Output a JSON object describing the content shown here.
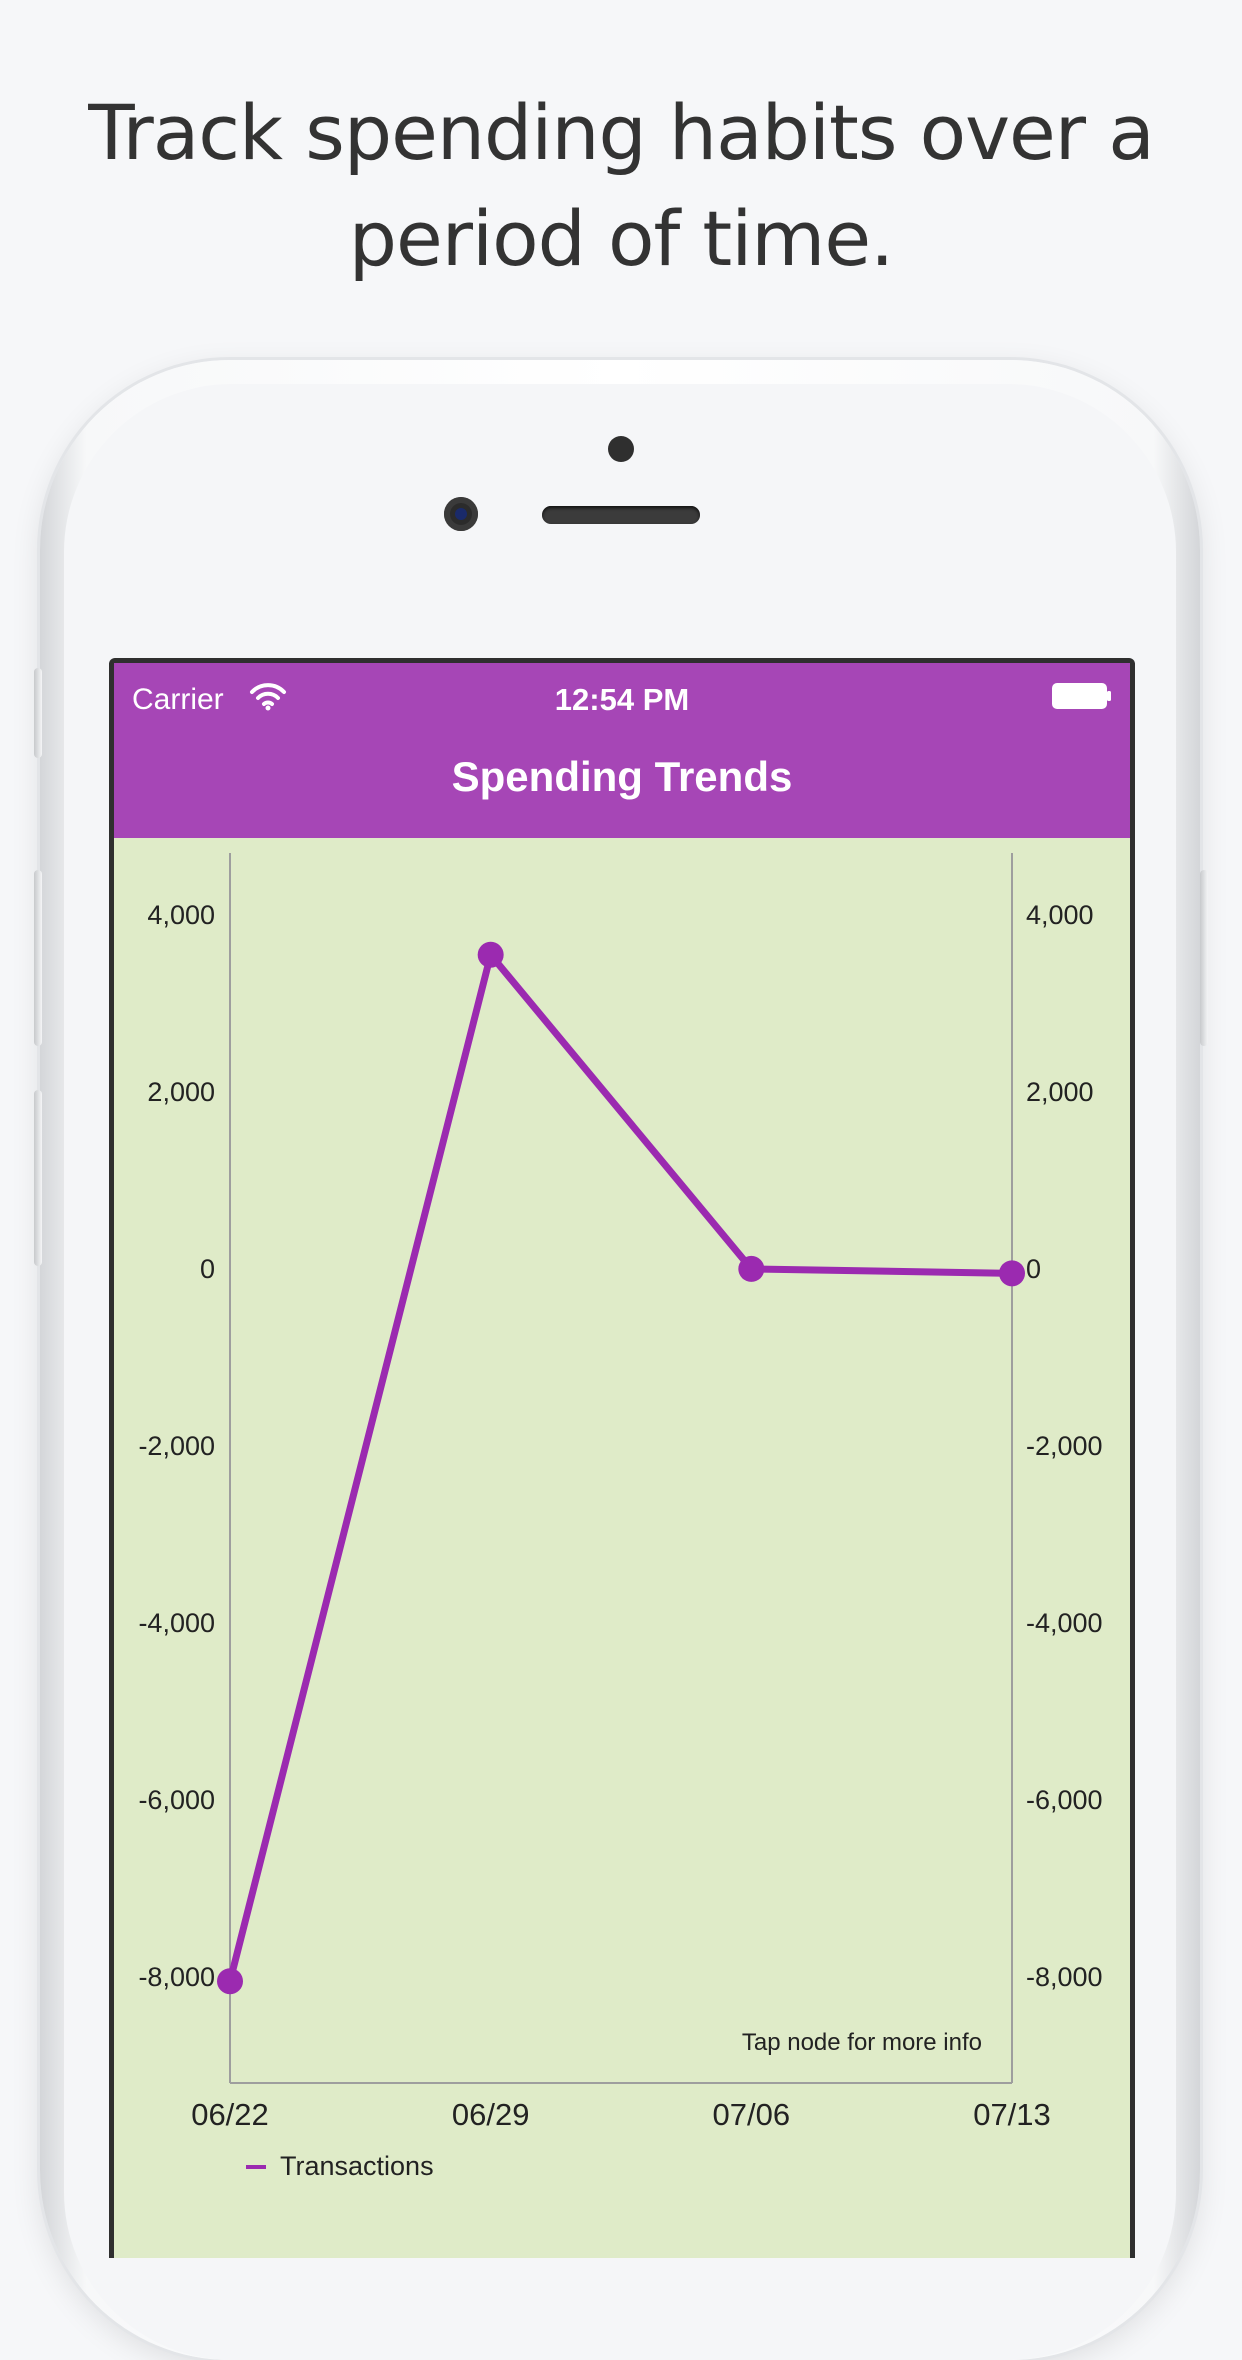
{
  "headline": {
    "line1": "Track spending habits over a",
    "line2": "period of time."
  },
  "status_bar": {
    "carrier": "Carrier",
    "time": "12:54 PM",
    "wifi_icon": "wifi-icon",
    "battery_icon": "battery-icon"
  },
  "nav": {
    "title": "Spending Trends"
  },
  "colors": {
    "nav_bg": "#a646b6",
    "chart_bg": "#dfebc8",
    "series": "#9b2ab0"
  },
  "chart_data": {
    "type": "line",
    "categories": [
      "06/22",
      "06/29",
      "07/06",
      "07/13"
    ],
    "series": [
      {
        "name": "Transactions",
        "values": [
          -8050,
          3550,
          0,
          -50
        ]
      }
    ],
    "ylim": [
      -9200,
      4700
    ],
    "yticks": [
      4000,
      2000,
      0,
      -2000,
      -4000,
      -6000,
      -8000
    ],
    "ytick_labels": [
      "4,000",
      "2,000",
      "0",
      "-2,000",
      "-4,000",
      "-6,000",
      "-8,000"
    ],
    "dual_y_axis": true,
    "annotation": "Tap node for more info",
    "legend_position": "bottom-left",
    "grid": false
  }
}
